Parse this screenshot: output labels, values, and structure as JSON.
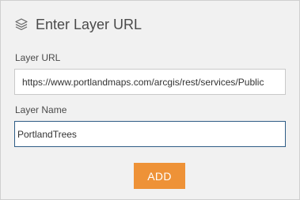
{
  "header": {
    "icon": "layers-icon",
    "title": "Enter Layer URL"
  },
  "form": {
    "layer_url": {
      "label": "Layer URL",
      "value": "https://www.portlandmaps.com/arcgis/rest/services/Public"
    },
    "layer_name": {
      "label": "Layer Name",
      "value": "PortlandTrees"
    },
    "add_button_label": "ADD"
  },
  "colors": {
    "panel_background": "#f1f1f1",
    "add_button": "#ee9237",
    "focus_border": "#2f5d86"
  }
}
